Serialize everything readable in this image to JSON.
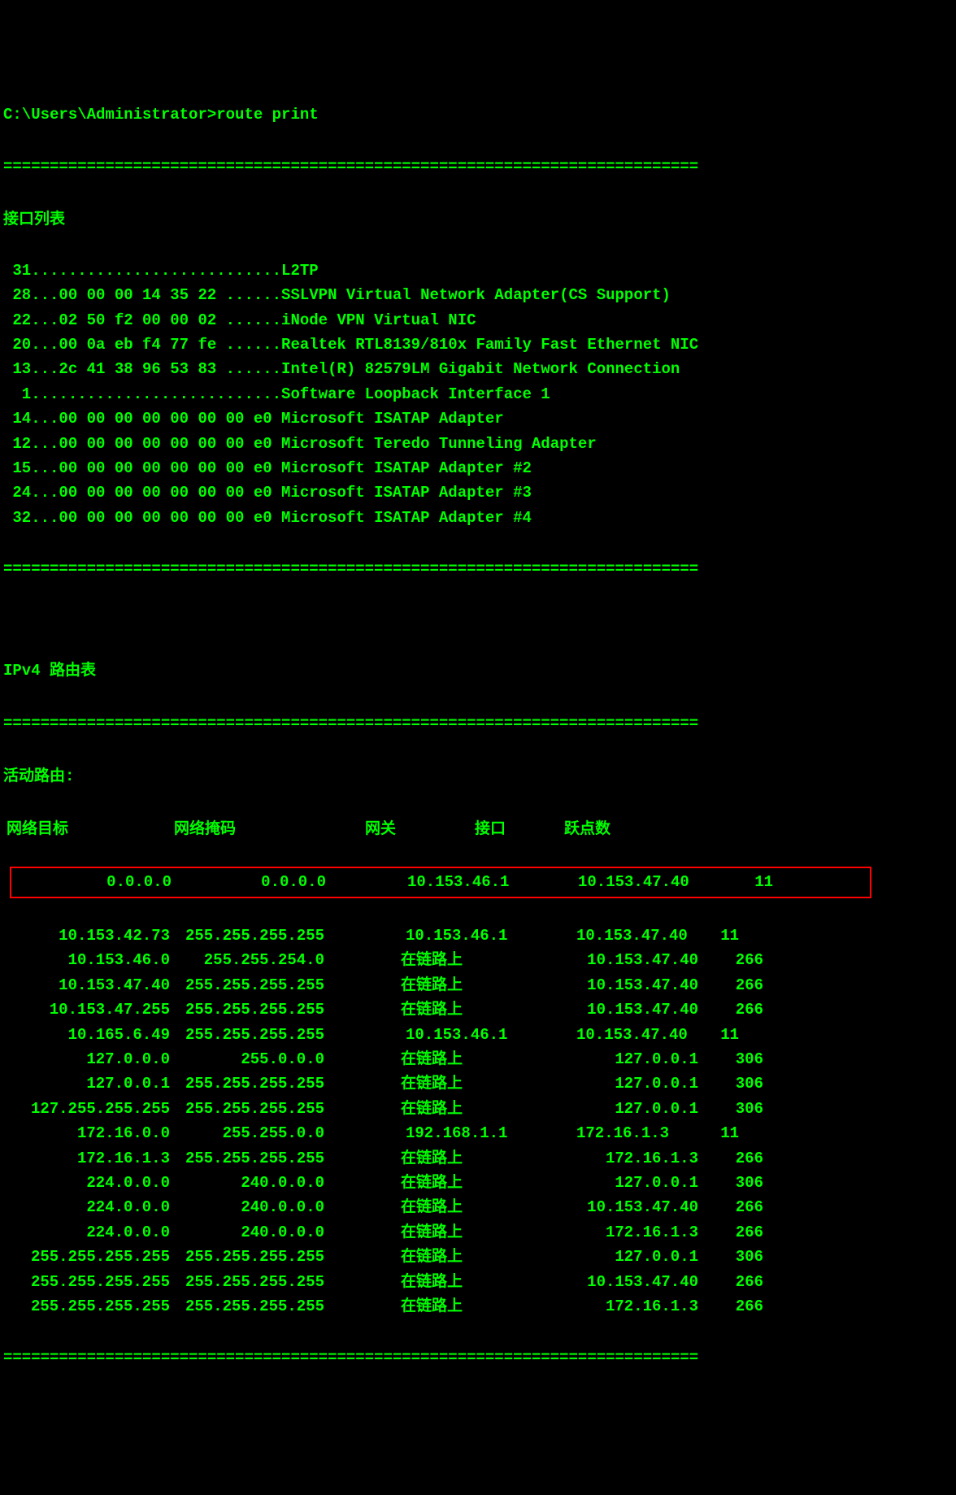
{
  "prompt": "C:\\Users\\Administrator>route print",
  "divider": "===========================================================================",
  "interface_list_title": "接口列表",
  "interfaces": [
    " 31...........................L2TP",
    " 28...00 00 00 14 35 22 ......SSLVPN Virtual Network Adapter(CS Support)",
    " 22...02 50 f2 00 00 02 ......iNode VPN Virtual NIC",
    " 20...00 0a eb f4 77 fe ......Realtek RTL8139/810x Family Fast Ethernet NIC",
    " 13...2c 41 38 96 53 83 ......Intel(R) 82579LM Gigabit Network Connection",
    "  1...........................Software Loopback Interface 1",
    " 14...00 00 00 00 00 00 00 e0 Microsoft ISATAP Adapter",
    " 12...00 00 00 00 00 00 00 e0 Microsoft Teredo Tunneling Adapter",
    " 15...00 00 00 00 00 00 00 e0 Microsoft ISATAP Adapter #2",
    " 24...00 00 00 00 00 00 00 e0 Microsoft ISATAP Adapter #3",
    " 32...00 00 00 00 00 00 00 e0 Microsoft ISATAP Adapter #4"
  ],
  "ipv4_title": "IPv4 路由表",
  "active_routes_title": "活动路由:",
  "headers": {
    "dest": "网络目标",
    "mask": "网络掩码",
    "gateway": "网关",
    "interface": "接口",
    "metric": "跃点数"
  },
  "highlighted_route": {
    "dest": "0.0.0.0",
    "mask": "0.0.0.0",
    "gateway": "10.153.46.1",
    "interface": "10.153.47.40",
    "metric": "11"
  },
  "routes": [
    {
      "dest": "10.153.42.73",
      "mask": "255.255.255.255",
      "gateway": "10.153.46.1",
      "interface": "10.153.47.40",
      "metric": "11"
    },
    {
      "dest": "10.153.46.0",
      "mask": "255.255.254.0",
      "gateway": "在链路上",
      "interface": "10.153.47.40",
      "metric": "266"
    },
    {
      "dest": "10.153.47.40",
      "mask": "255.255.255.255",
      "gateway": "在链路上",
      "interface": "10.153.47.40",
      "metric": "266"
    },
    {
      "dest": "10.153.47.255",
      "mask": "255.255.255.255",
      "gateway": "在链路上",
      "interface": "10.153.47.40",
      "metric": "266"
    },
    {
      "dest": "10.165.6.49",
      "mask": "255.255.255.255",
      "gateway": "10.153.46.1",
      "interface": "10.153.47.40",
      "metric": "11"
    },
    {
      "dest": "127.0.0.0",
      "mask": "255.0.0.0",
      "gateway": "在链路上",
      "interface": "127.0.0.1",
      "metric": "306"
    },
    {
      "dest": "127.0.0.1",
      "mask": "255.255.255.255",
      "gateway": "在链路上",
      "interface": "127.0.0.1",
      "metric": "306"
    },
    {
      "dest": "127.255.255.255",
      "mask": "255.255.255.255",
      "gateway": "在链路上",
      "interface": "127.0.0.1",
      "metric": "306"
    },
    {
      "dest": "172.16.0.0",
      "mask": "255.255.0.0",
      "gateway": "192.168.1.1",
      "interface": "172.16.1.3",
      "metric": "11"
    },
    {
      "dest": "172.16.1.3",
      "mask": "255.255.255.255",
      "gateway": "在链路上",
      "interface": "172.16.1.3",
      "metric": "266"
    },
    {
      "dest": "224.0.0.0",
      "mask": "240.0.0.0",
      "gateway": "在链路上",
      "interface": "127.0.0.1",
      "metric": "306"
    },
    {
      "dest": "224.0.0.0",
      "mask": "240.0.0.0",
      "gateway": "在链路上",
      "interface": "10.153.47.40",
      "metric": "266"
    },
    {
      "dest": "224.0.0.0",
      "mask": "240.0.0.0",
      "gateway": "在链路上",
      "interface": "172.16.1.3",
      "metric": "266"
    },
    {
      "dest": "255.255.255.255",
      "mask": "255.255.255.255",
      "gateway": "在链路上",
      "interface": "127.0.0.1",
      "metric": "306"
    },
    {
      "dest": "255.255.255.255",
      "mask": "255.255.255.255",
      "gateway": "在链路上",
      "interface": "10.153.47.40",
      "metric": "266"
    },
    {
      "dest": "255.255.255.255",
      "mask": "255.255.255.255",
      "gateway": "在链路上",
      "interface": "172.16.1.3",
      "metric": "266"
    }
  ]
}
